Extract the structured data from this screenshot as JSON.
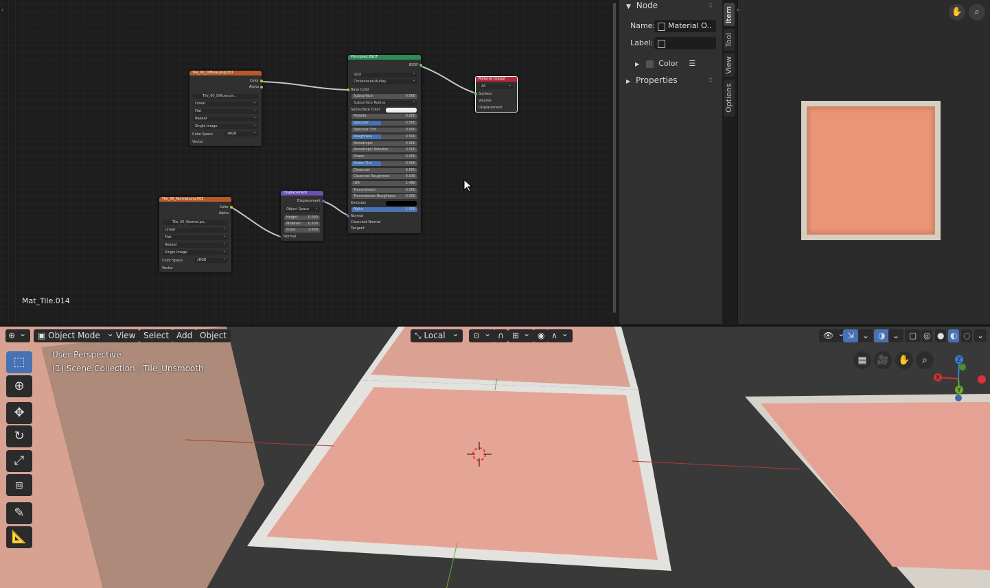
{
  "node_editor": {
    "material_name": "Mat_Tile.014",
    "nodes": {
      "diffuse_image": {
        "title": "Tile_00_Diffuse.png.037",
        "outputs": [
          "Color",
          "Alpha"
        ],
        "image_name": "Tile_00_Diffuse.pn..",
        "interpolation": "Linear",
        "projection": "Flat",
        "extension": "Repeat",
        "source": "Single Image",
        "color_space_label": "Color Space",
        "color_space": "sRGB",
        "vector_label": "Vector"
      },
      "normal_image": {
        "title": "Tile_00_Normal.png.002",
        "outputs": [
          "Color",
          "Alpha"
        ],
        "image_name": "Tile_00_Normal.pn..",
        "interpolation": "Linear",
        "projection": "Flat",
        "extension": "Repeat",
        "source": "Single Image",
        "color_space_label": "Color Space",
        "color_space": "sRGB",
        "vector_label": "Vector"
      },
      "displacement": {
        "title": "Displacement",
        "output": "Displacement",
        "space": "Object Space",
        "height_label": "Height",
        "height": "0.000",
        "midlevel_label": "Midlevel",
        "midlevel": "0.500",
        "scale_label": "Scale",
        "scale": "1.000",
        "normal_label": "Normal"
      },
      "principled": {
        "title": "Principled BSDF",
        "output": "BSDF",
        "distribution": "GGX",
        "subsurface_method": "Christensen-Burley",
        "base_color": "Base Color",
        "subsurface": {
          "label": "Subsurface",
          "value": "0.000"
        },
        "subsurface_radius": "Subsurface Radius",
        "subsurface_color": "Subsurface Color",
        "metallic": {
          "label": "Metallic",
          "value": "0.000"
        },
        "specular": {
          "label": "Specular",
          "value": "0.500",
          "fill": 0.5
        },
        "specular_tint": {
          "label": "Specular Tint",
          "value": "0.000"
        },
        "roughness": {
          "label": "Roughness",
          "value": "0.500",
          "fill": 0.5
        },
        "anisotropic": {
          "label": "Anisotropic",
          "value": "0.000"
        },
        "anisotropic_rotation": {
          "label": "Anisotropic Rotation",
          "value": "0.000"
        },
        "sheen": {
          "label": "Sheen",
          "value": "0.000"
        },
        "sheen_tint": {
          "label": "Sheen Tint",
          "value": "0.500",
          "fill": 0.5
        },
        "clearcoat": {
          "label": "Clearcoat",
          "value": "0.000"
        },
        "clearcoat_roughness": {
          "label": "Clearcoat Roughness",
          "value": "0.030"
        },
        "ior": {
          "label": "IOR",
          "value": "1.450"
        },
        "transmission": {
          "label": "Transmission",
          "value": "0.000"
        },
        "transmission_roughness": {
          "label": "Transmission Roughness",
          "value": "0.000"
        },
        "emission": "Emission",
        "alpha": {
          "label": "Alpha",
          "value": "1.000",
          "fill": 1.0
        },
        "normal": "Normal",
        "clearcoat_normal": "Clearcoat Normal",
        "tangent": "Tangent"
      },
      "material_output": {
        "title": "Material Output",
        "target": "All",
        "inputs": [
          "Surface",
          "Volume",
          "Displacement"
        ]
      }
    }
  },
  "sidebar": {
    "panel_node": "Node",
    "name_label": "Name:",
    "name_value": "Material O..",
    "label_label": "Label:",
    "label_value": "",
    "color_label": "Color",
    "properties_label": "Properties",
    "tabs": [
      "Item",
      "Tool",
      "View",
      "Options"
    ]
  },
  "viewport": {
    "mode": "Object Mode",
    "menus": [
      "View",
      "Select",
      "Add",
      "Object"
    ],
    "transform_orientation": "Local",
    "info_line1": "User Perspective",
    "info_line2": "(1) Scene Collection | Tile_Unsmooth",
    "gizmo": {
      "x": "X",
      "y": "Y",
      "z": "Z"
    }
  },
  "colors": {
    "image_header": "#b55a2a",
    "bsdf_header": "#2f8a57",
    "output_header": "#b52a3a",
    "displacement_header": "#6b4fb5",
    "accent": "#4772b3",
    "tile": "#e8917c"
  }
}
